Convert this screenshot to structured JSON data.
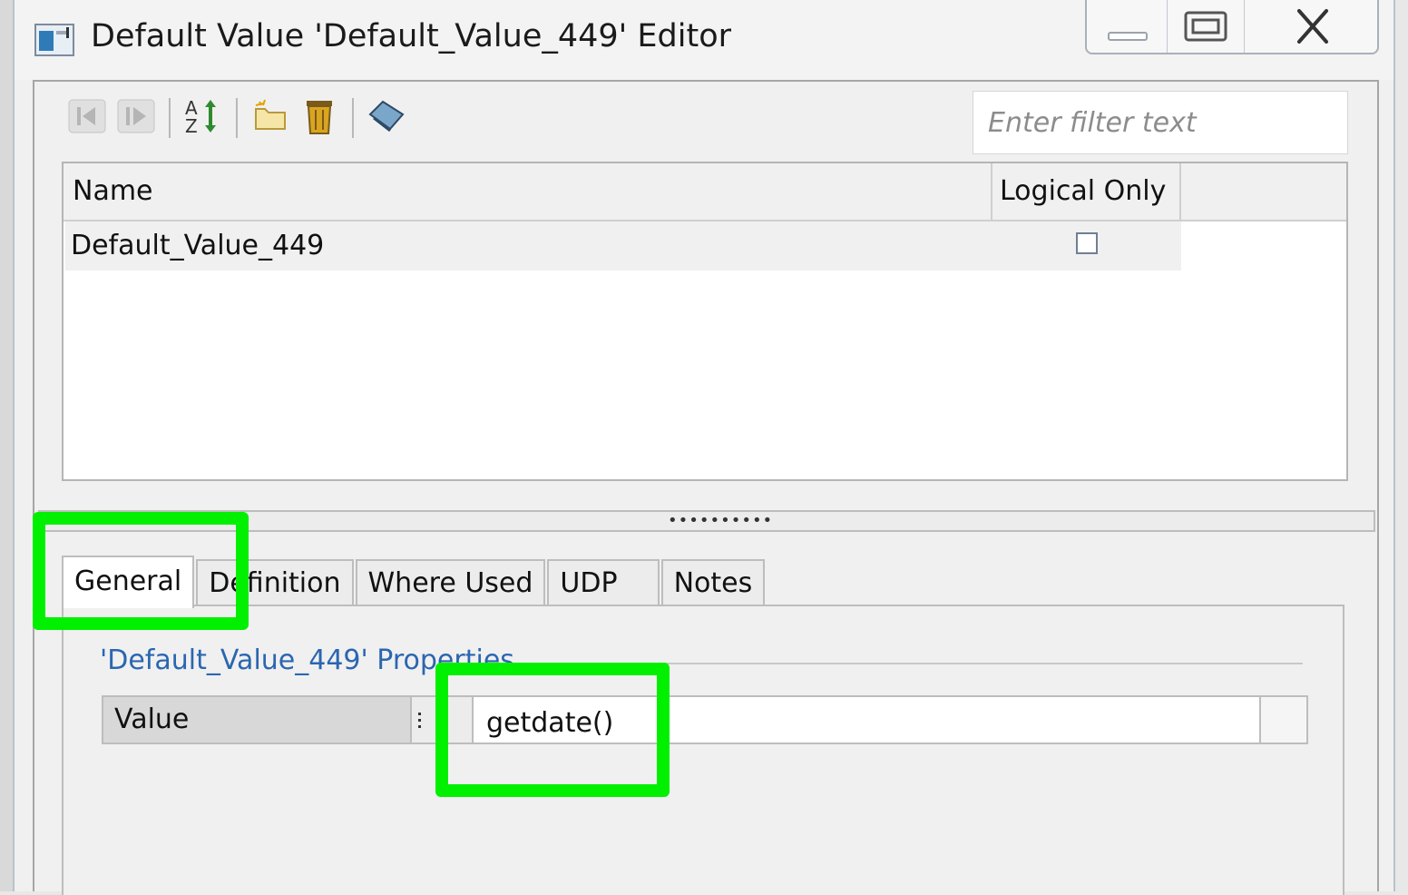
{
  "window": {
    "title": "Default Value 'Default_Value_449' Editor",
    "icons": [
      "app-window-icon",
      "minimize-icon",
      "maximize-icon",
      "close-icon"
    ]
  },
  "toolbar": {
    "buttons": [
      {
        "name": "first-record-icon",
        "enabled": false
      },
      {
        "name": "next-record-icon",
        "enabled": false
      },
      {
        "name": "sort-az-icon",
        "enabled": true
      },
      {
        "name": "new-item-icon",
        "enabled": true
      },
      {
        "name": "delete-icon",
        "enabled": true
      },
      {
        "name": "tag-icon",
        "enabled": true
      }
    ],
    "filter_placeholder": "Enter filter text"
  },
  "grid": {
    "columns": [
      "Name",
      "Logical Only"
    ],
    "rows": [
      {
        "name": "Default_Value_449",
        "logical_only": false
      }
    ]
  },
  "tabs": {
    "items": [
      "General",
      "Definition",
      "Where Used",
      "UDP",
      "Notes"
    ],
    "active": "General"
  },
  "properties": {
    "title": "'Default_Value_449' Properties",
    "rows": [
      {
        "label": "Value",
        "value": "getdate()"
      }
    ]
  },
  "colors": {
    "highlight": "#00f000",
    "section_title": "#2b66b0"
  }
}
